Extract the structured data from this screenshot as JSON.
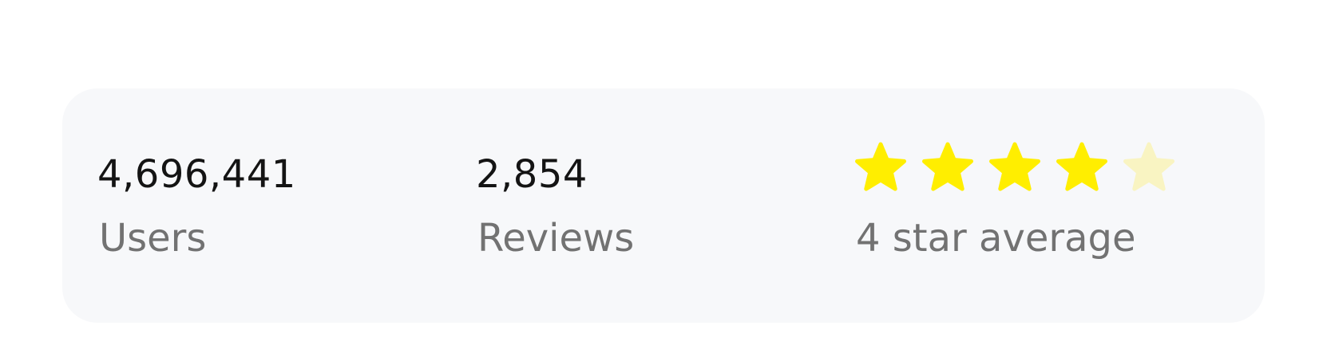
{
  "stats": {
    "users": {
      "value": "4,696,441",
      "label": "Users"
    },
    "reviews": {
      "value": "2,854",
      "label": "Reviews"
    },
    "rating": {
      "label": "4 star average",
      "stars_total": 5,
      "stars_filled": 4,
      "star_icon": "star-icon"
    }
  },
  "colors": {
    "card_background": "#f7f8fa",
    "value_text": "#141414",
    "label_text": "#727272",
    "star_filled": "#ffee00",
    "star_empty": "#f9f4c2"
  }
}
